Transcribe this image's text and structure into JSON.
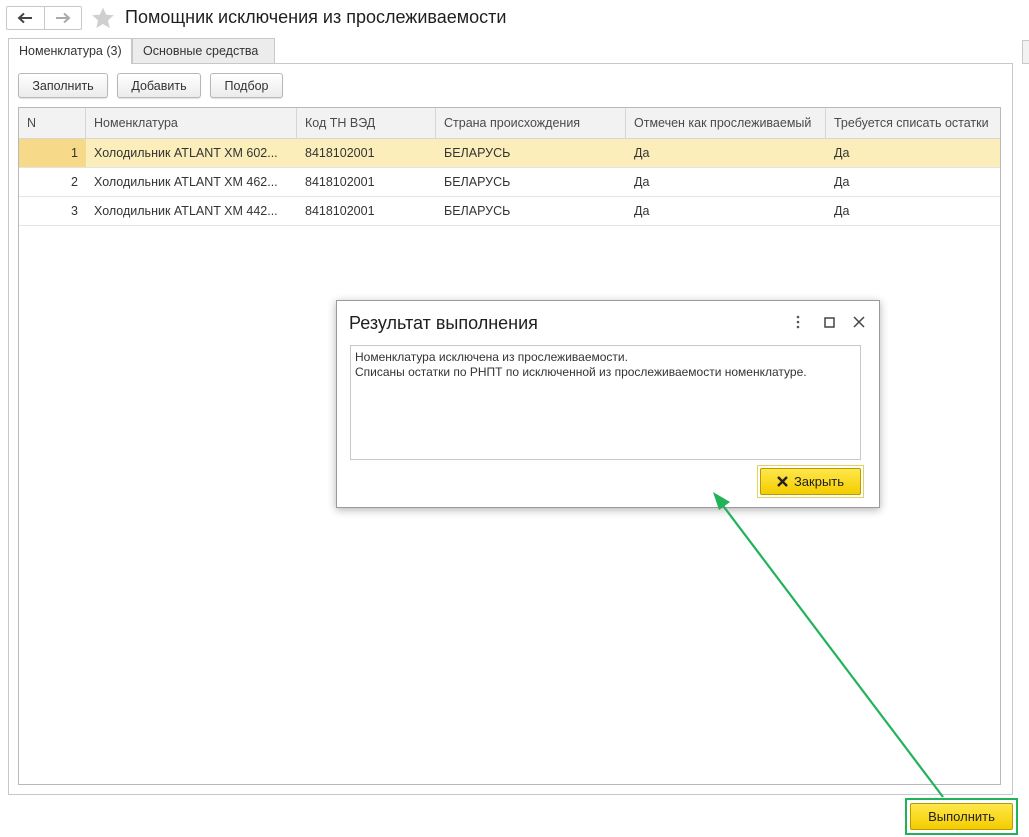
{
  "header": {
    "title": "Помощник исключения из прослеживаемости",
    "back_icon": "arrow-left-icon",
    "forward_icon": "arrow-right-icon",
    "favorite_icon": "star-icon"
  },
  "tabs": [
    {
      "label": "Номенклатура (3)",
      "active": true
    },
    {
      "label": "Основные средства",
      "active": false
    }
  ],
  "toolbar": {
    "fill_label": "Заполнить",
    "add_label": "Добавить",
    "pick_label": "Подбор"
  },
  "table": {
    "columns": [
      "N",
      "Номенклатура",
      "Код ТН ВЭД",
      "Страна происхождения",
      "Отмечен как прослеживаемый",
      "Требуется списать остатки"
    ],
    "rows": [
      {
        "n": "1",
        "name": "Холодильник ATLANT XM 602...",
        "code": "8418102001",
        "country": "БЕЛАРУСЬ",
        "traceable": "Да",
        "writeoff": "Да",
        "selected": true
      },
      {
        "n": "2",
        "name": "Холодильник ATLANT XM 462...",
        "code": "8418102001",
        "country": "БЕЛАРУСЬ",
        "traceable": "Да",
        "writeoff": "Да",
        "selected": false
      },
      {
        "n": "3",
        "name": "Холодильник ATLANT XM 442...",
        "code": "8418102001",
        "country": "БЕЛАРУСЬ",
        "traceable": "Да",
        "writeoff": "Да",
        "selected": false
      }
    ]
  },
  "dialog": {
    "title": "Результат выполнения",
    "lines": [
      "Номенклатура исключена из прослеживаемости.",
      "Списаны остатки по РНПТ по исключенной из прослеживаемости номенклатуре."
    ],
    "close_label": "Закрыть",
    "menu_icon": "more-vertical-icon",
    "maximize_icon": "maximize-icon",
    "close_icon": "close-icon"
  },
  "footer": {
    "execute_label": "Выполнить"
  },
  "colors": {
    "selected_row": "#fbeebb",
    "primary_button": "#f4cd00",
    "highlight_green": "#22b35a"
  }
}
